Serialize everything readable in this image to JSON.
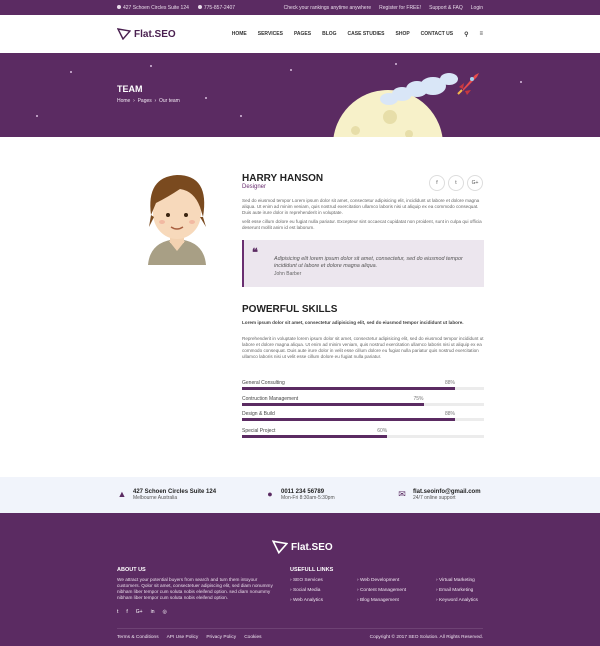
{
  "topbar": {
    "address": "427 Schoen Circles Suite 124",
    "phone": "775-857-2407",
    "links": [
      "Check your rankings anytime anywhere",
      "Register for FREE!",
      "Support & FAQ",
      "Login"
    ]
  },
  "nav": {
    "logo": "Flat.SEO",
    "items": [
      "HOME",
      "SERVICES",
      "PAGES",
      "BLOG",
      "CASE STUDIES",
      "SHOP",
      "CONTACT US"
    ]
  },
  "hero": {
    "title": "TEAM",
    "crumbs": [
      "Home",
      "Pages",
      "Our team"
    ]
  },
  "profile": {
    "name": "HARRY HANSON",
    "role": "Designer",
    "social": [
      "f",
      "t",
      "G+"
    ],
    "p1": "Sed do eiusmod tempor Lorem ipsum dolor sit amet, consectetur adipisicing elit, incididunt ut labore et dolore magna aliqua. Ut enim ad minim veniam, quis nostrud exercitation ullamco laboris nisi ut aliquip ex ea commodo consequat. Duis aute irure dolor in reprehenderit in voluptate.",
    "p2": "velit esse cillum dolore eu fugiat nulla pariatur. Excepteur sint occaecat cupidatat non proident, sunt in culpa qui officia deserunt mollit anim id est laborum.",
    "quote": "Adipisicing elit lorem ipsum dolor sit amet, consectetur, sed do eiusmod tempor incididunt ut labore et dolore magna aliqua.",
    "quote_author": "John Barber"
  },
  "skills": {
    "title": "POWERFUL SKILLS",
    "lead": "Lorem ipsum dolor sit amet, consectetur adipisicing elit, sed do eiusmod tempor incididunt ut labore.",
    "text": "Reprehenderit in voluptate lorem ipsum dolor sit amet, consectetur adipisicing elit, sed do eiusmod tempor incididunt ut labore et dolore magna aliqua. Ut enim ad minim veniam, quis nostrud exercitation ullamco laboris nisi ut aliquip ex ea commodo consequat. Duis aute irure dolor in velit esse cillum dolore eu fugiat nulla pariatur quis nostrud exercitation ullamco laboris nisi ut velit esse cillum dolore eu fugiat nulla pariatur.",
    "items": [
      {
        "label": "General Consulting",
        "pct": "88%",
        "value": 88
      },
      {
        "label": "Contruction Management",
        "pct": "75%",
        "value": 75
      },
      {
        "label": "Design & Build",
        "pct": "88%",
        "value": 88
      },
      {
        "label": "Special Project",
        "pct": "60%",
        "value": 60
      }
    ]
  },
  "contact": [
    {
      "icon": "building-icon",
      "t1": "427 Schoen Circles Suite 124",
      "t2": "Melbourne Australia"
    },
    {
      "icon": "user-icon",
      "t1": "0011 234 56789",
      "t2": "Mon-Fri 8:30am-5:30pm"
    },
    {
      "icon": "mail-icon",
      "t1": "flat.seoinfo@gmail.com",
      "t2": "24/7 online support"
    }
  ],
  "footer": {
    "logo": "Flat.SEO",
    "about_title": "ABOUT US",
    "about": "We attract your potential buyers from search and turn them intoyour customers. Qolor sit amet, consectetuer adipiscing elit, sed diam nonummy nibham liber tempor cum soluta nobis eleifend option. sed diam nonummy nibham liber tempor cum soluta nobis eleifend option.",
    "social": [
      "t",
      "f",
      "G+",
      "in",
      "◎"
    ],
    "links_title": "USEFULL LINKS",
    "links": [
      "SEO Services",
      "Web Development",
      "Virtual Marketing",
      "Social Media",
      "Content Management",
      "Email Marketing",
      "Web Analytics",
      "Blog Management",
      "Keyword Analytics"
    ],
    "bottom": [
      "Terms & Conditions",
      "API Use Policy",
      "Privacy Policy",
      "Cookies"
    ],
    "copyright": "Copyright © 2017 SEO Solution. All Rights Reserved."
  }
}
